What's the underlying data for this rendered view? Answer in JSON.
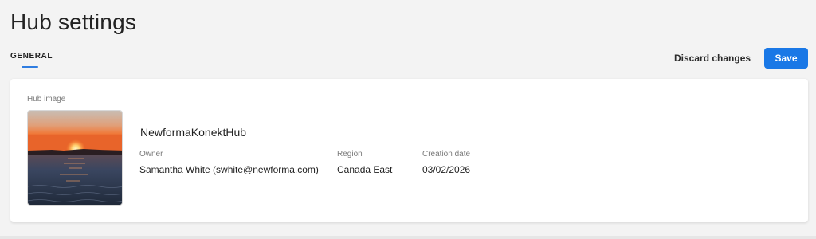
{
  "page": {
    "title": "Hub settings"
  },
  "tabs": [
    {
      "label": "GENERAL",
      "active": true
    }
  ],
  "actions": {
    "discard_label": "Discard changes",
    "save_label": "Save"
  },
  "colors": {
    "accent": "#1a78e6",
    "tab_underline": "#2f7de1",
    "background": "#f3f3f3",
    "card": "#ffffff"
  },
  "hub": {
    "image_label": "Hub image",
    "image_icon": "sunset-over-water-photo",
    "name": "NewformaKonektHub",
    "owner_label": "Owner",
    "owner_value": "Samantha White (swhite@newforma.com)",
    "region_label": "Region",
    "region_value": "Canada East",
    "date_label": "Creation date",
    "date_value": "03/02/2026"
  }
}
